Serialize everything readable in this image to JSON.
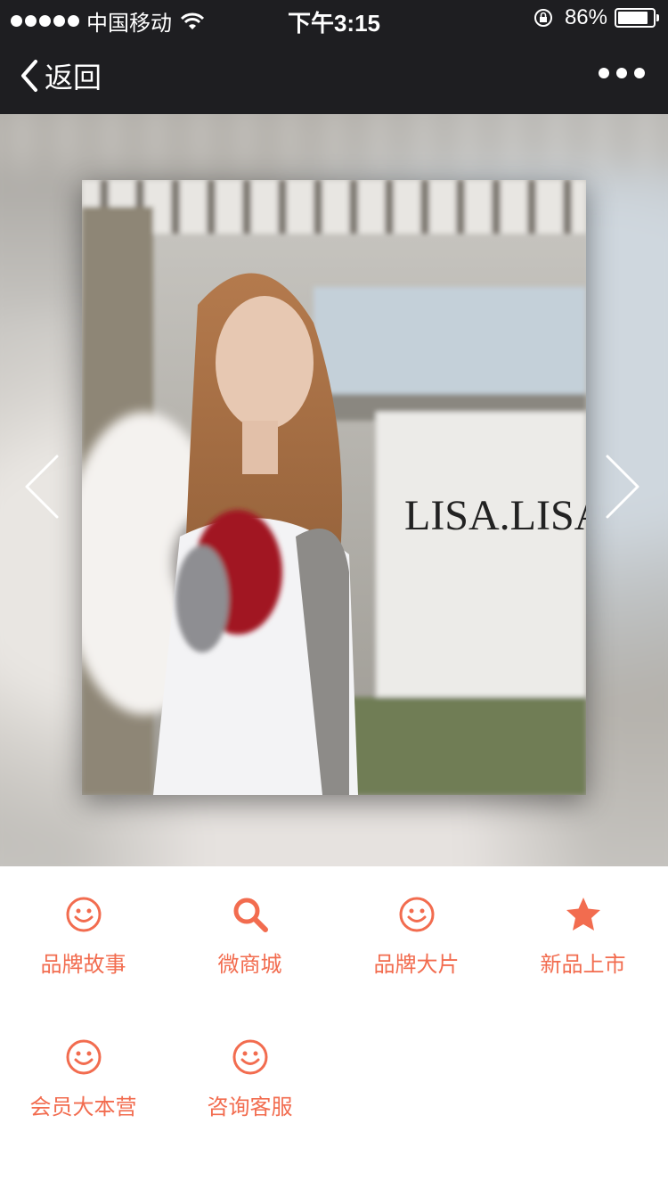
{
  "status": {
    "carrier": "中国移动",
    "time": "下午3:15",
    "battery_pct": "86%",
    "battery_level": 0.86
  },
  "nav": {
    "back_label": "返回",
    "back_icon": "chevron-left-icon",
    "more_icon": "more-dots-icon"
  },
  "hero": {
    "brand_text": "LISA.LISA",
    "prev_icon": "chevron-left-icon",
    "next_icon": "chevron-right-icon"
  },
  "menu": {
    "accent": "#f26c4f",
    "items": [
      {
        "label": "品牌故事",
        "icon": "smile-icon"
      },
      {
        "label": "微商城",
        "icon": "search-icon"
      },
      {
        "label": "品牌大片",
        "icon": "smile-icon"
      },
      {
        "label": "新品上市",
        "icon": "star-icon"
      },
      {
        "label": "会员大本营",
        "icon": "smile-icon"
      },
      {
        "label": "咨询客服",
        "icon": "smile-icon"
      }
    ]
  }
}
